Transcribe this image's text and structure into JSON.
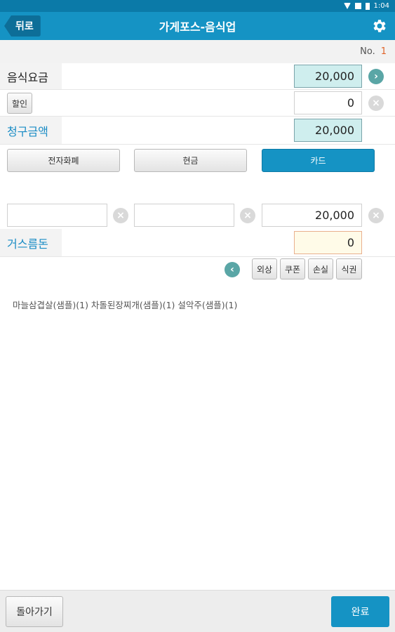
{
  "statusbar": {
    "time": "1:04"
  },
  "appbar": {
    "back_label": "뒤로",
    "title": "가게포스-음식업"
  },
  "order": {
    "no_label": "No.",
    "no_value": "1"
  },
  "food_charge": {
    "label": "음식요금",
    "value": "20,000"
  },
  "discount": {
    "button_label": "할인",
    "value": "0"
  },
  "bill_amount": {
    "label": "청구금액",
    "value": "20,000"
  },
  "payment_methods": {
    "e_money": "전자화폐",
    "cash": "현금",
    "card": "카드",
    "selected": "카드"
  },
  "payment_inputs": {
    "e_money_value": "",
    "cash_value": "",
    "card_value": "20,000"
  },
  "change": {
    "label": "거스름돈",
    "value": "0"
  },
  "extra_buttons": {
    "credit": "외상",
    "coupon": "쿠폰",
    "loss": "손실",
    "meal_ticket": "식권"
  },
  "items_text": "마늘삼겹살(샘플)(1) 차돌된장찌개(샘플)(1) 설악주(샘플)(1)",
  "footer": {
    "back_label": "돌아가기",
    "done_label": "완료"
  },
  "colors": {
    "primary": "#1593c4",
    "teal_field": "#cfeeee",
    "accent_label": "#1a8cc5",
    "no_value": "#e0642a"
  }
}
